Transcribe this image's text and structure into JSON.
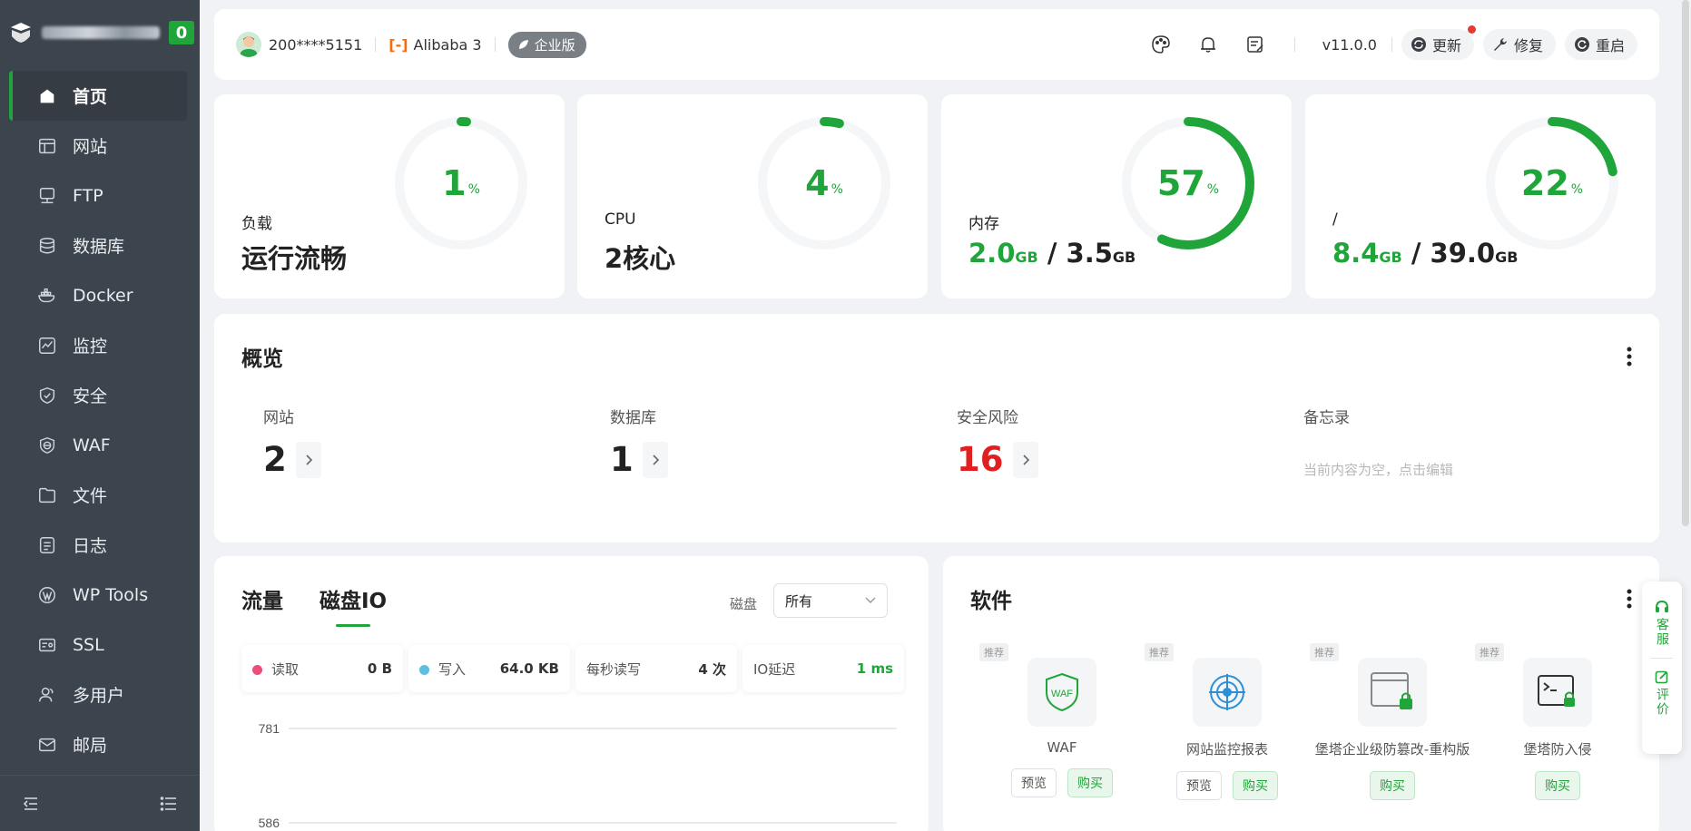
{
  "sidebar": {
    "badge": "0",
    "items": [
      {
        "label": "首页",
        "icon": "home-icon"
      },
      {
        "label": "网站",
        "icon": "website-icon"
      },
      {
        "label": "FTP",
        "icon": "ftp-icon"
      },
      {
        "label": "数据库",
        "icon": "database-icon"
      },
      {
        "label": "Docker",
        "icon": "docker-icon"
      },
      {
        "label": "监控",
        "icon": "monitor-icon"
      },
      {
        "label": "安全",
        "icon": "shield-icon"
      },
      {
        "label": "WAF",
        "icon": "waf-icon"
      },
      {
        "label": "文件",
        "icon": "folder-icon"
      },
      {
        "label": "日志",
        "icon": "log-icon"
      },
      {
        "label": "WP Tools",
        "icon": "wordpress-icon"
      },
      {
        "label": "SSL",
        "icon": "ssl-icon"
      },
      {
        "label": "多用户",
        "icon": "users-icon"
      },
      {
        "label": "邮局",
        "icon": "mail-icon"
      }
    ]
  },
  "topbar": {
    "user": "200****5151",
    "cloud": "Alibaba 3",
    "edition": "企业版",
    "version": "v11.0.0",
    "update_label": "更新",
    "repair_label": "修复",
    "restart_label": "重启"
  },
  "stats": {
    "load": {
      "label": "负载",
      "value": "运行流畅",
      "percent": 1,
      "percent_text": "1",
      "unit": "%"
    },
    "cpu": {
      "label": "CPU",
      "value": "2核心",
      "percent": 4,
      "percent_text": "4",
      "unit": "%"
    },
    "mem": {
      "label": "内存",
      "used": "2.0",
      "total": "3.5",
      "size_unit": "GB",
      "sep": "/",
      "percent": 57,
      "percent_text": "57",
      "unit": "%"
    },
    "disk": {
      "label": "/",
      "used": "8.4",
      "total": "39.0",
      "size_unit": "GB",
      "sep": "/",
      "percent": 22,
      "percent_text": "22",
      "unit": "%"
    }
  },
  "overview": {
    "title": "概览",
    "items": [
      {
        "label": "网站",
        "value": "2"
      },
      {
        "label": "数据库",
        "value": "1"
      },
      {
        "label": "安全风险",
        "value": "16"
      }
    ],
    "memo_label": "备忘录",
    "memo_text": "当前内容为空，点击编辑"
  },
  "io": {
    "tab_traffic": "流量",
    "tab_disk": "磁盘IO",
    "disk_label": "磁盘",
    "disk_value": "所有",
    "read_label": "读取",
    "read_value": "0 B",
    "write_label": "写入",
    "write_value": "64.0 KB",
    "rw_label": "每秒读写",
    "rw_value": "4 次",
    "latency_label": "IO延迟",
    "latency_value": "1 ms",
    "colors": {
      "read": "#e94f7a",
      "write": "#5bc0de"
    }
  },
  "chart_data": {
    "type": "line",
    "yticks": [
      781,
      586
    ],
    "series": []
  },
  "software": {
    "title": "软件",
    "rec_label": "推荐",
    "preview_label": "预览",
    "buy_label": "购买",
    "items": [
      {
        "name": "WAF",
        "icon": "waf-shield-icon"
      },
      {
        "name": "网站监控报表",
        "icon": "radar-icon"
      },
      {
        "name": "堡塔企业级防篡改-重构版",
        "icon": "tamper-lock-icon"
      },
      {
        "name": "堡塔防入侵",
        "icon": "terminal-lock-icon"
      }
    ]
  },
  "float": {
    "service": "客服",
    "review": "评价"
  },
  "accent": "#20a53a",
  "danger": "#e02020"
}
